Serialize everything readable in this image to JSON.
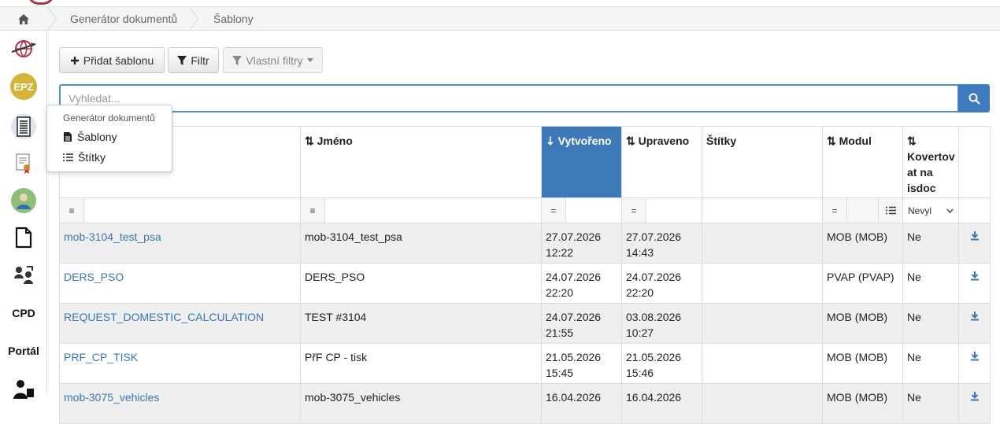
{
  "breadcrumb": {
    "items": [
      "Generátor dokumentů",
      "Šablony"
    ]
  },
  "sidebar": {
    "cpd_label": "CPD",
    "portal_label": "Portál",
    "epz_label": "EPZ"
  },
  "popover": {
    "title": "Generátor dokumentů",
    "items": [
      "Šablony",
      "Štítky"
    ]
  },
  "toolbar": {
    "add_label": "Přidat šablonu",
    "filter_label": "Filtr",
    "custom_filters_label": "Vlastní filtry"
  },
  "search": {
    "placeholder": "Vyhledat..."
  },
  "table": {
    "headers": [
      "Jméno",
      "Vytvořeno",
      "Upraveno",
      "Štítky",
      "Modul",
      "Kovertov at na isdoc"
    ],
    "filter_ops": [
      "≡",
      "≡",
      "=",
      "=",
      "="
    ],
    "filter_select": "Nevyl",
    "rows": [
      {
        "code": "mob-3104_test_psa",
        "name": "mob-3104_test_psa",
        "created_date": "27.07.2026",
        "created_time": "12:22",
        "updated_date": "27.07.2026",
        "updated_time": "14:43",
        "tags": "",
        "module": "MOB (MOB)",
        "convert": "Ne"
      },
      {
        "code": "DERS_PSO",
        "name": "DERS_PSO",
        "created_date": "24.07.2026",
        "created_time": "22:20",
        "updated_date": "24.07.2026",
        "updated_time": "22:20",
        "tags": "",
        "module": "PVAP (PVAP)",
        "convert": "Ne"
      },
      {
        "code": "REQUEST_DOMESTIC_CALCULATION",
        "name": "TEST #3104",
        "created_date": "24.07.2026",
        "created_time": "21:55",
        "updated_date": "03.08.2026",
        "updated_time": "10:27",
        "tags": "",
        "module": "MOB (MOB)",
        "convert": "Ne"
      },
      {
        "code": "PRF_CP_TISK",
        "name": "PřF CP - tisk",
        "created_date": "21.05.2026",
        "created_time": "15:45",
        "updated_date": "21.05.2026",
        "updated_time": "15:46",
        "tags": "",
        "module": "MOB (MOB)",
        "convert": "Ne"
      },
      {
        "code": "mob-3075_vehicles",
        "name": "mob-3075_vehicles",
        "created_date": "16.04.2026",
        "created_time": "",
        "updated_date": "16.04.2026",
        "updated_time": "",
        "tags": "",
        "module": "MOB (MOB)",
        "convert": "Ne"
      }
    ]
  },
  "colors": {
    "accent": "#3e79b7",
    "link": "#3c76b4",
    "row_alt": "#efefef"
  }
}
